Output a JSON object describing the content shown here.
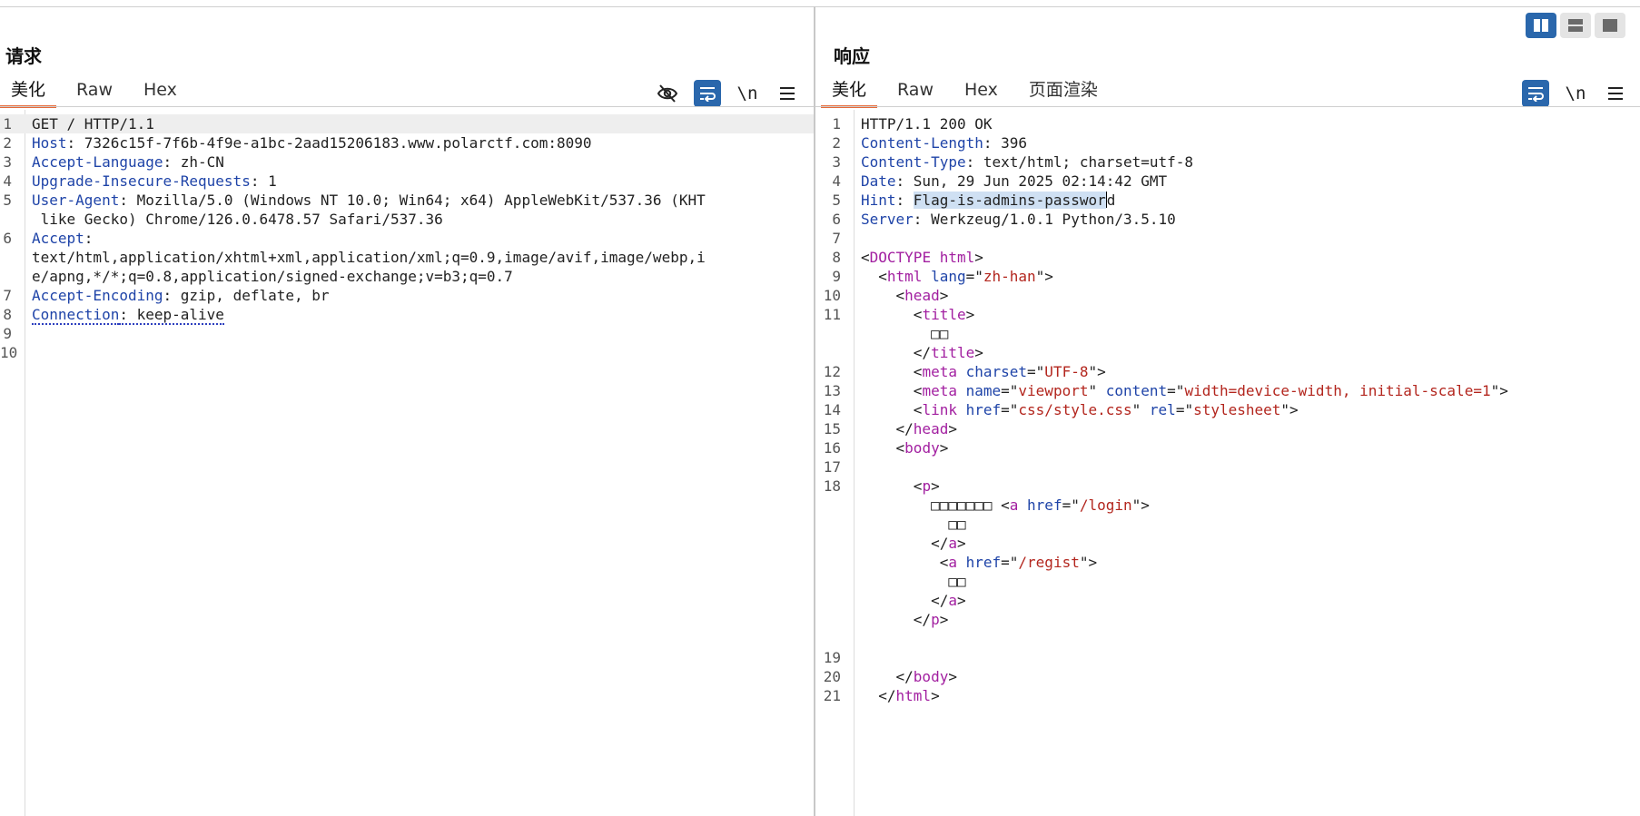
{
  "request": {
    "title": "请求",
    "tabs": [
      "美化",
      "Raw",
      "Hex"
    ],
    "active_tab": "美化",
    "tools": {
      "hide_icon": "eye-off-icon",
      "wrap_icon": "wrap-icon",
      "newline_label": "\\n",
      "menu_icon": "menu-icon"
    },
    "lines": [
      {
        "n": "1",
        "parts": [
          {
            "t": "GET / HTTP/1.1",
            "c": "hv"
          }
        ]
      },
      {
        "n": "2",
        "parts": [
          {
            "t": "Host",
            "c": "hn"
          },
          {
            "t": ": 7326c15f-7f6b-4f9e-a1bc-2aad15206183.www.polarctf.com:8090",
            "c": "hv"
          }
        ]
      },
      {
        "n": "3",
        "parts": [
          {
            "t": "Accept-Language",
            "c": "hn"
          },
          {
            "t": ": zh-CN",
            "c": "hv"
          }
        ]
      },
      {
        "n": "4",
        "parts": [
          {
            "t": "Upgrade-Insecure-Requests",
            "c": "hn"
          },
          {
            "t": ": 1",
            "c": "hv"
          }
        ]
      },
      {
        "n": "5",
        "parts": [
          {
            "t": "User-Agent",
            "c": "hn"
          },
          {
            "t": ": Mozilla/5.0 (Windows NT 10.0; Win64; x64) AppleWebKit/537.36 (KHT",
            "c": "hv"
          }
        ]
      },
      {
        "n": "",
        "parts": [
          {
            "t": " like Gecko) Chrome/126.0.6478.57 Safari/537.36",
            "c": "hv"
          }
        ]
      },
      {
        "n": "6",
        "parts": [
          {
            "t": "Accept",
            "c": "hn"
          },
          {
            "t": ":",
            "c": "hv"
          }
        ]
      },
      {
        "n": "",
        "parts": [
          {
            "t": "text/html,application/xhtml+xml,application/xml;q=0.9,image/avif,image/webp,i",
            "c": "hv"
          }
        ]
      },
      {
        "n": "",
        "parts": [
          {
            "t": "e/apng,*/*;q=0.8,application/signed-exchange;v=b3;q=0.7",
            "c": "hv"
          }
        ]
      },
      {
        "n": "7",
        "parts": [
          {
            "t": "Accept-Encoding",
            "c": "hn"
          },
          {
            "t": ": gzip, deflate, br",
            "c": "hv"
          }
        ]
      },
      {
        "n": "8",
        "parts": [
          {
            "t": "Connection",
            "c": "hn dotted"
          },
          {
            "t": ": keep-alive",
            "c": "hv dotted"
          }
        ]
      },
      {
        "n": "9",
        "parts": []
      },
      {
        "n": "10",
        "parts": []
      }
    ]
  },
  "response": {
    "title": "响应",
    "tabs": [
      "美化",
      "Raw",
      "Hex",
      "页面渲染"
    ],
    "active_tab": "美化",
    "tools": {
      "wrap_icon": "wrap-icon",
      "newline_label": "\\n",
      "menu_icon": "menu-icon"
    },
    "lines": [
      {
        "n": "1",
        "parts": [
          {
            "t": "HTTP/1.1 200 OK",
            "c": "hv"
          }
        ]
      },
      {
        "n": "2",
        "parts": [
          {
            "t": "Content-Length",
            "c": "hn"
          },
          {
            "t": ": 396",
            "c": "hv"
          }
        ]
      },
      {
        "n": "3",
        "parts": [
          {
            "t": "Content-Type",
            "c": "hn"
          },
          {
            "t": ": text/html; charset=utf-8",
            "c": "hv"
          }
        ]
      },
      {
        "n": "4",
        "parts": [
          {
            "t": "Date",
            "c": "hn"
          },
          {
            "t": ": Sun, 29 Jun 2025 02:14:42 GMT",
            "c": "hv"
          }
        ]
      },
      {
        "n": "5",
        "parts": [
          {
            "t": "Hint",
            "c": "hn"
          },
          {
            "t": ": ",
            "c": "hv"
          },
          {
            "t": "Flag-is-admins-passwor",
            "c": "hv sel"
          },
          {
            "caret": true
          },
          {
            "t": "d",
            "c": "hv"
          }
        ]
      },
      {
        "n": "6",
        "parts": [
          {
            "t": "Server",
            "c": "hn"
          },
          {
            "t": ": Werkzeug/1.0.1 Python/3.5.10",
            "c": "hv"
          }
        ]
      },
      {
        "n": "7",
        "parts": []
      },
      {
        "n": "8",
        "parts": [
          {
            "t": "<",
            "c": "tx"
          },
          {
            "t": "DOCTYPE html",
            "c": "tg"
          },
          {
            "t": ">",
            "c": "tx"
          }
        ]
      },
      {
        "n": "9",
        "parts": [
          {
            "t": "  <",
            "c": "tx"
          },
          {
            "t": "html",
            "c": "tg"
          },
          {
            "t": " lang",
            "c": "at"
          },
          {
            "t": "=\"",
            "c": "tx"
          },
          {
            "t": "zh-han",
            "c": "st"
          },
          {
            "t": "\">",
            "c": "tx"
          }
        ]
      },
      {
        "n": "10",
        "parts": [
          {
            "t": "    <",
            "c": "tx"
          },
          {
            "t": "head",
            "c": "tg"
          },
          {
            "t": ">",
            "c": "tx"
          }
        ]
      },
      {
        "n": "11",
        "parts": [
          {
            "t": "      <",
            "c": "tx"
          },
          {
            "t": "title",
            "c": "tg"
          },
          {
            "t": ">",
            "c": "tx"
          }
        ]
      },
      {
        "n": "",
        "parts": [
          {
            "t": "        □□",
            "c": "tx"
          }
        ]
      },
      {
        "n": "",
        "parts": [
          {
            "t": "      </",
            "c": "tx"
          },
          {
            "t": "title",
            "c": "tg"
          },
          {
            "t": ">",
            "c": "tx"
          }
        ]
      },
      {
        "n": "12",
        "parts": [
          {
            "t": "      <",
            "c": "tx"
          },
          {
            "t": "meta",
            "c": "tg"
          },
          {
            "t": " charset",
            "c": "at"
          },
          {
            "t": "=\"",
            "c": "tx"
          },
          {
            "t": "UTF-8",
            "c": "st"
          },
          {
            "t": "\">",
            "c": "tx"
          }
        ]
      },
      {
        "n": "13",
        "parts": [
          {
            "t": "      <",
            "c": "tx"
          },
          {
            "t": "meta",
            "c": "tg"
          },
          {
            "t": " name",
            "c": "at"
          },
          {
            "t": "=\"",
            "c": "tx"
          },
          {
            "t": "viewport",
            "c": "st"
          },
          {
            "t": "\"",
            "c": "tx"
          },
          {
            "t": " content",
            "c": "at"
          },
          {
            "t": "=\"",
            "c": "tx"
          },
          {
            "t": "width=device-width, initial-scale=1",
            "c": "st"
          },
          {
            "t": "\">",
            "c": "tx"
          }
        ]
      },
      {
        "n": "14",
        "parts": [
          {
            "t": "      <",
            "c": "tx"
          },
          {
            "t": "link",
            "c": "tg"
          },
          {
            "t": " href",
            "c": "at"
          },
          {
            "t": "=\"",
            "c": "tx"
          },
          {
            "t": "css/style.css",
            "c": "st"
          },
          {
            "t": "\"",
            "c": "tx"
          },
          {
            "t": " rel",
            "c": "at"
          },
          {
            "t": "=\"",
            "c": "tx"
          },
          {
            "t": "stylesheet",
            "c": "st"
          },
          {
            "t": "\">",
            "c": "tx"
          }
        ]
      },
      {
        "n": "15",
        "parts": [
          {
            "t": "    </",
            "c": "tx"
          },
          {
            "t": "head",
            "c": "tg"
          },
          {
            "t": ">",
            "c": "tx"
          }
        ]
      },
      {
        "n": "16",
        "parts": [
          {
            "t": "    <",
            "c": "tx"
          },
          {
            "t": "body",
            "c": "tg"
          },
          {
            "t": ">",
            "c": "tx"
          }
        ]
      },
      {
        "n": "17",
        "parts": []
      },
      {
        "n": "18",
        "parts": [
          {
            "t": "      <",
            "c": "tx"
          },
          {
            "t": "p",
            "c": "tg"
          },
          {
            "t": ">",
            "c": "tx"
          }
        ]
      },
      {
        "n": "",
        "parts": [
          {
            "t": "        □□□□□□□ <",
            "c": "tx"
          },
          {
            "t": "a",
            "c": "tg"
          },
          {
            "t": " href",
            "c": "at"
          },
          {
            "t": "=\"",
            "c": "tx"
          },
          {
            "t": "/login",
            "c": "st"
          },
          {
            "t": "\">",
            "c": "tx"
          }
        ]
      },
      {
        "n": "",
        "parts": [
          {
            "t": "          □□",
            "c": "tx"
          }
        ]
      },
      {
        "n": "",
        "parts": [
          {
            "t": "        </",
            "c": "tx"
          },
          {
            "t": "a",
            "c": "tg"
          },
          {
            "t": ">",
            "c": "tx"
          }
        ]
      },
      {
        "n": "",
        "parts": [
          {
            "t": "         <",
            "c": "tx"
          },
          {
            "t": "a",
            "c": "tg"
          },
          {
            "t": " href",
            "c": "at"
          },
          {
            "t": "=\"",
            "c": "tx"
          },
          {
            "t": "/regist",
            "c": "st"
          },
          {
            "t": "\">",
            "c": "tx"
          }
        ]
      },
      {
        "n": "",
        "parts": [
          {
            "t": "          □□",
            "c": "tx"
          }
        ]
      },
      {
        "n": "",
        "parts": [
          {
            "t": "        </",
            "c": "tx"
          },
          {
            "t": "a",
            "c": "tg"
          },
          {
            "t": ">",
            "c": "tx"
          }
        ]
      },
      {
        "n": "",
        "parts": [
          {
            "t": "      </",
            "c": "tx"
          },
          {
            "t": "p",
            "c": "tg"
          },
          {
            "t": ">",
            "c": "tx"
          }
        ]
      },
      {
        "n": "",
        "parts": []
      },
      {
        "n": "19",
        "parts": []
      },
      {
        "n": "20",
        "parts": [
          {
            "t": "    </",
            "c": "tx"
          },
          {
            "t": "body",
            "c": "tg"
          },
          {
            "t": ">",
            "c": "tx"
          }
        ]
      },
      {
        "n": "21",
        "parts": [
          {
            "t": "  </",
            "c": "tx"
          },
          {
            "t": "html",
            "c": "tg"
          },
          {
            "t": ">",
            "c": "tx"
          }
        ]
      }
    ]
  },
  "layout_toggle": {
    "buttons": [
      "split-horizontal-icon",
      "split-vertical-icon",
      "single-pane-icon"
    ],
    "active": "split-horizontal-icon"
  },
  "colors": {
    "accent": "#2a67ac",
    "tab_underline": "#e66a3a",
    "header_name": "#1f44a8",
    "tag": "#a21fa0",
    "string": "#b3261e"
  }
}
